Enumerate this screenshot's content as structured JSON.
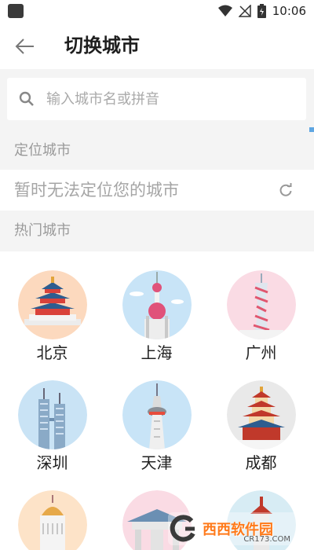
{
  "status_bar": {
    "time": "10:06"
  },
  "header": {
    "title": "切换城市"
  },
  "search": {
    "placeholder": "输入城市名或拼音"
  },
  "location_section": {
    "label": "定位城市",
    "status_text": "暂时无法定位您的城市"
  },
  "hot_section": {
    "label": "热门城市"
  },
  "cities": [
    {
      "name": "北京",
      "landmark": "temple-of-heaven",
      "bg": "#fcd9be"
    },
    {
      "name": "上海",
      "landmark": "oriental-pearl-tower",
      "bg": "#c8e4f7"
    },
    {
      "name": "广州",
      "landmark": "canton-tower",
      "bg": "#fadbe4"
    },
    {
      "name": "深圳",
      "landmark": "twin-towers",
      "bg": "#c9e3f5"
    },
    {
      "name": "天津",
      "landmark": "tv-tower",
      "bg": "#c8e4f7"
    },
    {
      "name": "成都",
      "landmark": "pagoda",
      "bg": "#e9e9e9"
    },
    {
      "name": "",
      "landmark": "domed-building",
      "bg": "#fde3c8"
    },
    {
      "name": "",
      "landmark": "gateway",
      "bg": "#fadbe4"
    },
    {
      "name": "",
      "landmark": "tower",
      "bg": "#d7ecf4"
    }
  ],
  "watermark": {
    "title": "西西软件园",
    "subtitle": "CR173.COM"
  },
  "colors": {
    "accent": "#5fa6e2",
    "section_bg": "#f4f4f4",
    "muted_text": "#a5a5a5"
  }
}
